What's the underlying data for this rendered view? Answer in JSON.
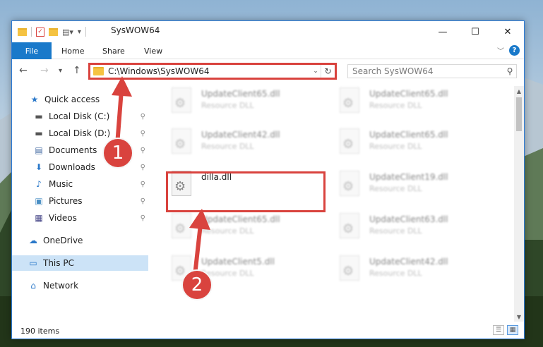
{
  "window": {
    "title": "SysWOW64",
    "controls": {
      "minimize": "—",
      "maximize": "☐",
      "close": "✕"
    }
  },
  "ribbon": {
    "tabs": [
      "File",
      "Home",
      "Share",
      "View"
    ],
    "help": "?",
    "expand": "﹀"
  },
  "nav": {
    "back": "←",
    "forward": "→",
    "recent": "▾",
    "up": "↑",
    "address": "C:\\Windows\\SysWOW64",
    "dropdown": "⌄",
    "refresh": "↻"
  },
  "search": {
    "placeholder": "Search SysWOW64",
    "value": "",
    "icon": "search-icon"
  },
  "sidebar": {
    "items": [
      {
        "label": "Quick access",
        "icon": "star-icon",
        "glyph": "★",
        "pinned": false
      },
      {
        "label": "Local Disk (C:)",
        "icon": "drive-icon",
        "glyph": "▬",
        "pinned": true
      },
      {
        "label": "Local Disk (D:)",
        "icon": "drive-icon",
        "glyph": "▬",
        "pinned": true
      },
      {
        "label": "Documents",
        "icon": "documents-icon",
        "glyph": "▤",
        "pinned": true
      },
      {
        "label": "Downloads",
        "icon": "download-icon",
        "glyph": "⬇",
        "pinned": true
      },
      {
        "label": "Music",
        "icon": "music-icon",
        "glyph": "♪",
        "pinned": true
      },
      {
        "label": "Pictures",
        "icon": "pictures-icon",
        "glyph": "▣",
        "pinned": true
      },
      {
        "label": "Videos",
        "icon": "videos-icon",
        "glyph": "▦",
        "pinned": true
      },
      {
        "label": "OneDrive",
        "icon": "cloud-icon",
        "glyph": "☁",
        "pinned": false
      },
      {
        "label": "This PC",
        "icon": "computer-icon",
        "glyph": "▭",
        "pinned": false,
        "active": true
      },
      {
        "label": "Network",
        "icon": "network-icon",
        "glyph": "⌂",
        "pinned": false
      }
    ],
    "pin_glyph": "📌"
  },
  "files": [
    {
      "name": "UpdateClient65.dll",
      "type": "Resource DLL",
      "blurred": true
    },
    {
      "name": "UpdateClient65.dll",
      "type": "Resource DLL",
      "blurred": true
    },
    {
      "name": "UpdateClient42.dll",
      "type": "Resource DLL",
      "blurred": true
    },
    {
      "name": "UpdateClient65.dll",
      "type": "Resource DLL",
      "blurred": true
    },
    {
      "name": "dilla.dll",
      "type": "",
      "blurred": false
    },
    {
      "name": "UpdateClient19.dll",
      "type": "Resource DLL",
      "blurred": true
    },
    {
      "name": "UpdateClient65.dll",
      "type": "Resource DLL",
      "blurred": true
    },
    {
      "name": "UpdateClient63.dll",
      "type": "Resource DLL",
      "blurred": true
    },
    {
      "name": "UpdateClient5.dll",
      "type": "Resource DLL",
      "blurred": true
    },
    {
      "name": "UpdateClient42.dll",
      "type": "Resource DLL",
      "blurred": true
    }
  ],
  "status": {
    "count": "190 items"
  },
  "annotations": {
    "step1": "1",
    "step2": "2",
    "color": "#d9433e"
  },
  "colors": {
    "accent": "#1979ca",
    "highlight": "#d9433e",
    "selection": "#cce3f7"
  }
}
